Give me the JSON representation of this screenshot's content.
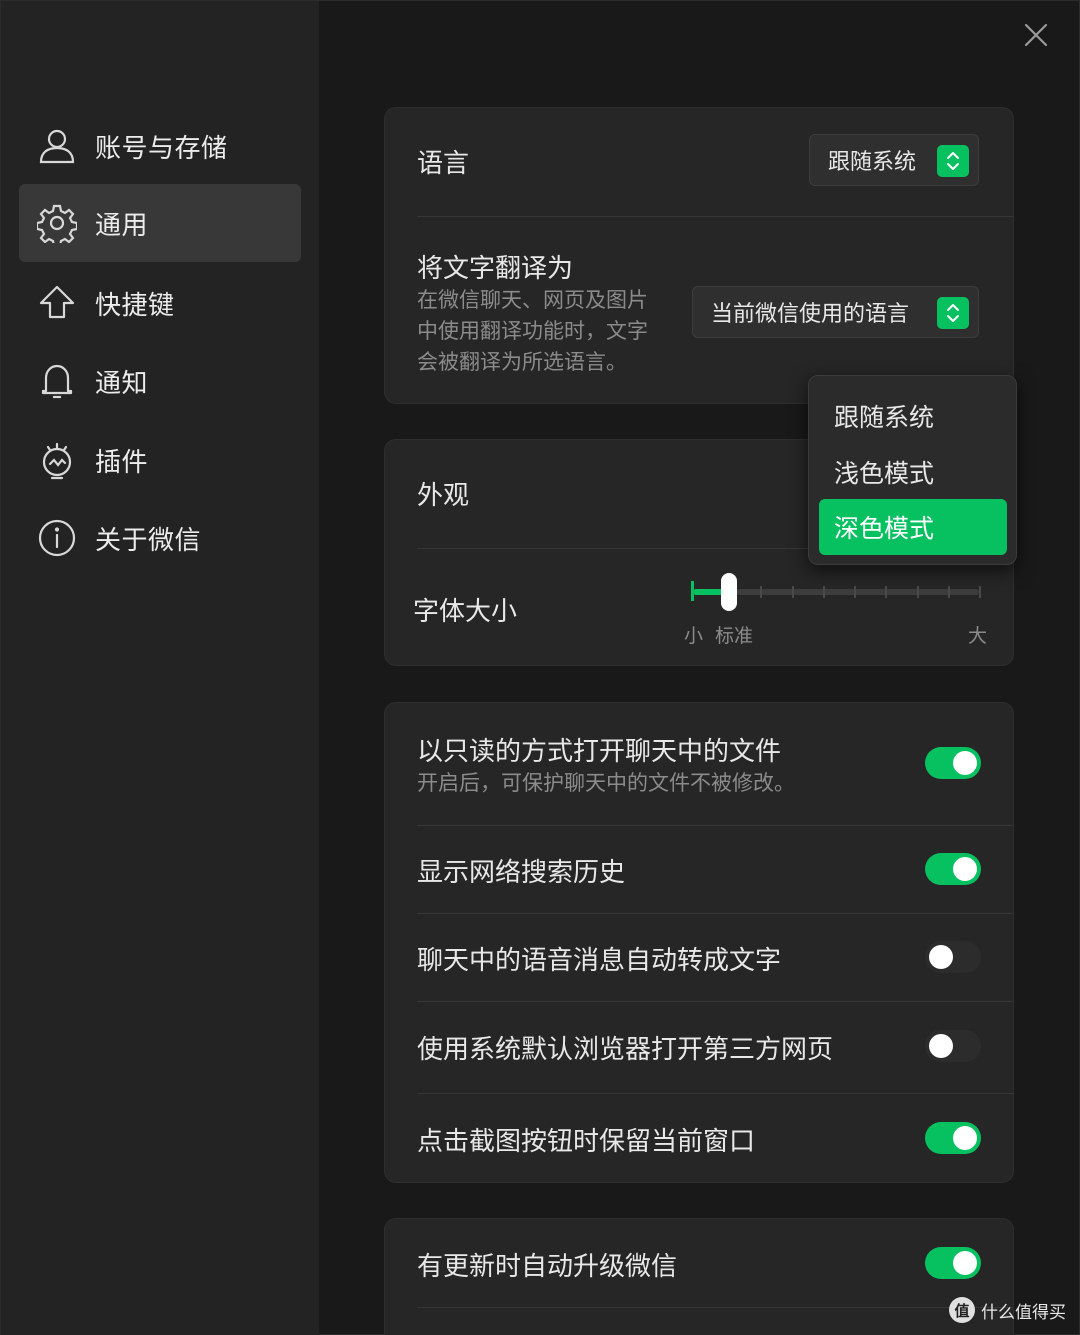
{
  "sidebar": {
    "items": [
      {
        "label": "账号与存储",
        "icon": "user-icon"
      },
      {
        "label": "通用",
        "icon": "gear-icon",
        "active": true
      },
      {
        "label": "快捷键",
        "icon": "shortcut-arrow-icon"
      },
      {
        "label": "通知",
        "icon": "bell-icon"
      },
      {
        "label": "插件",
        "icon": "plugin-icon"
      },
      {
        "label": "关于微信",
        "icon": "info-icon"
      }
    ]
  },
  "language": {
    "label": "语言",
    "value": "跟随系统"
  },
  "translate": {
    "label": "将文字翻译为",
    "description": [
      "在微信聊天、网页及图片",
      "中使用翻译功能时，文字",
      "会被翻译为所选语言。"
    ],
    "value": "当前微信使用的语言"
  },
  "appearance": {
    "label": "外观",
    "options": [
      "跟随系统",
      "浅色模式",
      "深色模式"
    ],
    "selected": "深色模式"
  },
  "font_size": {
    "label": "字体大小",
    "min_label": "小",
    "default_label": "标准",
    "max_label": "大",
    "steps": 9,
    "current_step": 1
  },
  "toggles": [
    {
      "label": "以只读的方式打开聊天中的文件",
      "description": "开启后，可保护聊天中的文件不被修改。",
      "on": true
    },
    {
      "label": "显示网络搜索历史",
      "on": true
    },
    {
      "label": "聊天中的语音消息自动转成文字",
      "on": false
    },
    {
      "label": "使用系统默认浏览器打开第三方网页",
      "on": false
    },
    {
      "label": "点击截图按钮时保留当前窗口",
      "on": true
    }
  ],
  "update": {
    "label": "有更新时自动升级微信",
    "on": true
  },
  "watermark": {
    "logo": "值",
    "text": "什么值得买"
  },
  "colors": {
    "accent": "#07c160",
    "background": "#191919",
    "sidebar": "#232323",
    "card": "#262626"
  }
}
